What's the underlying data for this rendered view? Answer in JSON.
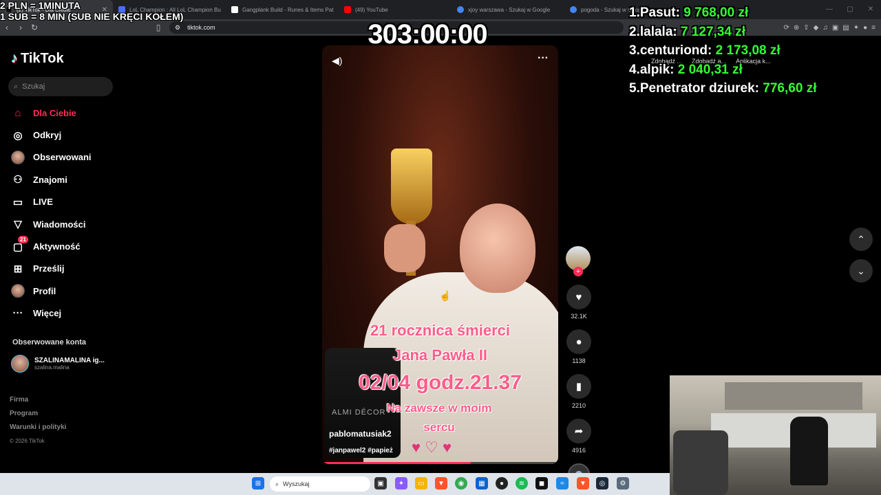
{
  "browser": {
    "tabs": [
      {
        "title": "(2) TikTok - Dla Ciebie",
        "active": true,
        "color": "#111111"
      },
      {
        "title": "LoL Champion : All LoL Champion Bu",
        "active": false,
        "color": "#4a6cf7"
      },
      {
        "title": "Gangplank Build - Runes & Items Pat",
        "active": false,
        "color": "#ffffff"
      },
      {
        "title": "(49) YouTube",
        "active": false,
        "color": "#ff0000"
      },
      {
        "title": "xjoy warszawa - Szukaj w Google",
        "active": false,
        "color": "#4285f4"
      },
      {
        "title": "pogoda - Szukaj w Google",
        "active": false,
        "color": "#4285f4"
      }
    ],
    "url": "tiktok.com",
    "bookmarks": [
      "Zdobądź ...",
      "Zdobądź a...",
      "Aplikacja k..."
    ]
  },
  "overlay": {
    "donation_line1": "2 PLN = 1MINUTA",
    "donation_line2": "1 SUB = 8 MIN (SUB NIE KRĘCI KOŁEM)",
    "timer": "303:00:00",
    "leaderboard": [
      {
        "rank": "1.",
        "name": "Pasut:",
        "amount": "9 768,00 zł"
      },
      {
        "rank": "2.",
        "name": "lalala:",
        "amount": "7 127,34 zł"
      },
      {
        "rank": "3.",
        "name": "centuriond:",
        "amount": "2 173,08 zł"
      },
      {
        "rank": "4.",
        "name": "alpik:",
        "amount": "2 040,31 zł"
      },
      {
        "rank": "5.",
        "name": "Penetrator dziurek:",
        "amount": "776,60 zł"
      }
    ]
  },
  "tiktok": {
    "logo": "TikTok",
    "search_placeholder": "Szukaj",
    "nav": [
      {
        "label": "Dla Ciebie",
        "icon": "home-icon",
        "active": true
      },
      {
        "label": "Odkryj",
        "icon": "compass-icon"
      },
      {
        "label": "Obserwowani",
        "icon": "avatar"
      },
      {
        "label": "Znajomi",
        "icon": "friends-icon"
      },
      {
        "label": "LIVE",
        "icon": "live-icon"
      },
      {
        "label": "Wiadomości",
        "icon": "send-icon"
      },
      {
        "label": "Aktywność",
        "icon": "activity-icon",
        "badge": "21"
      },
      {
        "label": "Prześlij",
        "icon": "upload-icon"
      },
      {
        "label": "Profil",
        "icon": "avatar"
      },
      {
        "label": "Więcej",
        "icon": "more-icon"
      }
    ],
    "followed_title": "Obserwowane konta",
    "followed": [
      {
        "name": "SZALINAMALINA ig...",
        "handle": "szalina.malina"
      }
    ],
    "footer": [
      "Firma",
      "Program",
      "Warunki i polityki"
    ],
    "copyright": "© 2026 TikTok",
    "video": {
      "text_line1": "21 rocznica śmierci",
      "text_line2": "Jana Pawła II",
      "text_line3": "02/04 godz.21.37",
      "text_line4": "Na zawsze w moim",
      "text_line5": "sercu",
      "candle_brand": "ALMI DÉCOR",
      "author": "pablomatusiak2",
      "tags": "#janpawel2 #papież",
      "progress": 0.63
    },
    "actions": {
      "likes": "32.1K",
      "comments": "1138",
      "saves": "2210",
      "shares": "4916"
    }
  },
  "taskbar": {
    "search_placeholder": "Wyszukaj"
  }
}
